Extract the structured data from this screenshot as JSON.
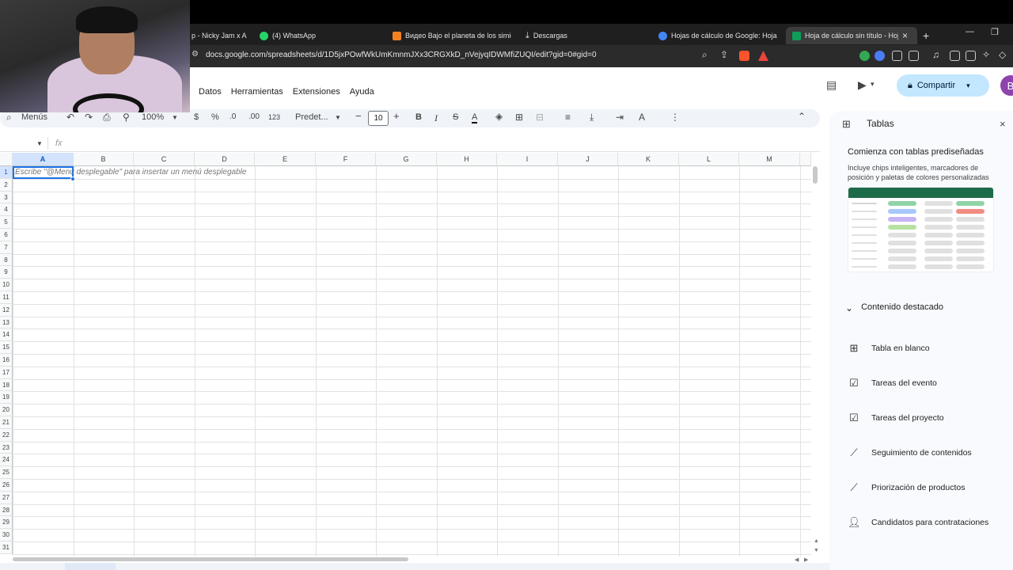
{
  "browser": {
    "tabs": [
      {
        "label": "p - Nicky Jam x Ar",
        "fav": "#d93025"
      },
      {
        "label": "(4) WhatsApp",
        "fav": "#25d366"
      },
      {
        "label": "Видео Bajo el planeta de los simios (",
        "fav": "#f48120"
      },
      {
        "label": "Descargas",
        "fav": "#9aa0a6"
      },
      {
        "label": "Hojas de cálculo de Google: Hojas d",
        "fav": "#4285f4"
      },
      {
        "label": "Hoja de cálculo sin título - Hoja",
        "fav": "#0f9d58"
      }
    ],
    "tab_close": "×",
    "new_tab": "+",
    "url": "docs.google.com/spreadsheets/d/1D5jxPOwfWkUmKmnmJXx3CRGXkD_nVejyqIDWMfiZUQI/edit?gid=0#gid=0"
  },
  "sheets": {
    "menu": [
      "Datos",
      "Herramientas",
      "Extensiones",
      "Ayuda"
    ],
    "share_label": "Compartir",
    "avatar_letter": "B",
    "toolbar": {
      "search_label": "Menús",
      "zoom": "100%",
      "currency": "$",
      "percent": "%",
      "dec_decrease": ".0",
      "dec_increase": ".00",
      "number_format": "123",
      "font": "Predet...",
      "font_size": "10",
      "minus": "−",
      "plus": "+",
      "bold": "B",
      "italic": "I",
      "strike": "S",
      "text_color": "A"
    },
    "name_box": "",
    "fx": "fx",
    "columns": [
      "A",
      "B",
      "C",
      "D",
      "E",
      "F",
      "G",
      "H",
      "I",
      "J",
      "K",
      "L",
      "M"
    ],
    "selected_column": "A",
    "rows": [
      "1",
      "2",
      "3",
      "4",
      "5",
      "6",
      "7",
      "8",
      "9",
      "10",
      "11",
      "12",
      "13",
      "14",
      "15",
      "16",
      "17",
      "18",
      "19",
      "20",
      "21",
      "22",
      "23",
      "24",
      "25",
      "26",
      "27",
      "28",
      "29",
      "30",
      "31"
    ],
    "cell_hint": "Escribe \"@Menú desplegable\" para insertar un menú desplegable"
  },
  "panel": {
    "title": "Tablas",
    "close": "×",
    "subtitle": "Comienza con tablas prediseñadas",
    "description": "Incluye chips inteligentes, marcadores de posición y paletas de colores personalizadas",
    "featured_label": "Contenido destacado",
    "items": [
      {
        "label": "Tabla en blanco",
        "icon": "table-icon"
      },
      {
        "label": "Tareas del evento",
        "icon": "checklist-icon"
      },
      {
        "label": "Tareas del proyecto",
        "icon": "checklist-icon"
      },
      {
        "label": "Seguimiento de contenidos",
        "icon": "trend-icon"
      },
      {
        "label": "Priorización de productos",
        "icon": "trend-icon"
      },
      {
        "label": "Candidatos para contrataciones",
        "icon": "person-icon"
      }
    ]
  }
}
